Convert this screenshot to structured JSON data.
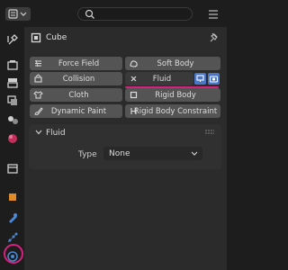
{
  "header": {
    "search_placeholder": "",
    "editor_icon": "properties-editor-icon",
    "search_icon": "search-icon",
    "filter_icon": "filter-icon"
  },
  "sidebar": {
    "tabs": [
      {
        "icon": "tool-icon"
      },
      {
        "icon": "render-icon"
      },
      {
        "icon": "output-icon"
      },
      {
        "icon": "view-layer-icon"
      },
      {
        "icon": "scene-icon"
      },
      {
        "icon": "world-icon"
      },
      {
        "icon": "collection-icon"
      },
      {
        "icon": "object-icon"
      },
      {
        "icon": "modifier-icon"
      },
      {
        "icon": "particles-icon"
      },
      {
        "icon": "physics-icon",
        "active": true
      }
    ]
  },
  "object": {
    "name": "Cube",
    "icon": "cube-icon",
    "pin_icon": "pin-icon"
  },
  "physics_buttons": [
    {
      "label": "Force Field",
      "icon": "force-field-icon"
    },
    {
      "label": "Soft Body",
      "icon": "soft-body-icon"
    },
    {
      "label": "Collision",
      "icon": "collision-icon"
    },
    {
      "label": "Fluid",
      "icon": "close-icon",
      "active": true
    },
    {
      "label": "Cloth",
      "icon": "cloth-icon"
    },
    {
      "label": "Rigid Body",
      "icon": "rigid-body-icon"
    },
    {
      "label": "Dynamic Paint",
      "icon": "dynamic-paint-icon"
    },
    {
      "label": "Rigid Body Constraint",
      "icon": "rigid-body-constraint-icon"
    }
  ],
  "fluid_panel": {
    "title": "Fluid",
    "type_label": "Type",
    "type_value": "None"
  },
  "colors": {
    "accent": "#d6217f",
    "toggle_blue": "#4a76c7",
    "button_bg": "#545454",
    "panel_bg": "#2b2b2b"
  }
}
